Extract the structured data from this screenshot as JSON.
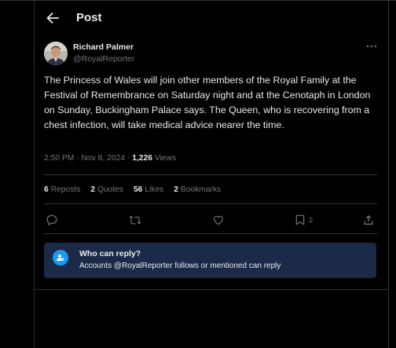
{
  "header": {
    "title": "Post"
  },
  "tweet": {
    "author_name": "Richard Palmer",
    "author_handle": "@RoyalReporter",
    "text": "The Princess of Wales will join other members of the Royal Family at the Festival of Remembrance on Saturday night and at the Cenotaph in London on Sunday, Buckingham Palace says. The Queen, who is recovering from a chest infection, will take medical advice nearer the time.",
    "timestamp": "2:50 PM · Nov 8, 2024 · ",
    "views_count": "1,226",
    "views_label": " Views"
  },
  "stats": {
    "reposts_count": "6",
    "reposts_label": "Reposts",
    "quotes_count": "2",
    "quotes_label": "Quotes",
    "likes_count": "56",
    "likes_label": "Likes",
    "bookmarks_count": "2",
    "bookmarks_label": "Bookmarks"
  },
  "actions": {
    "bookmark_count": "2"
  },
  "reply_settings": {
    "title": "Who can reply?",
    "subtitle": "Accounts @RoyalReporter follows or mentioned can reply"
  },
  "icons": [
    "back-arrow-icon",
    "more-icon",
    "reply-icon",
    "repost-icon",
    "like-icon",
    "bookmark-icon",
    "share-icon",
    "user-mention-icon"
  ],
  "colors": {
    "background": "#000000",
    "text": "#e7e9ea",
    "muted": "#71767b",
    "accent": "#1d9bf0",
    "reply_box": "#1c2a4a",
    "border": "#2f3336"
  }
}
